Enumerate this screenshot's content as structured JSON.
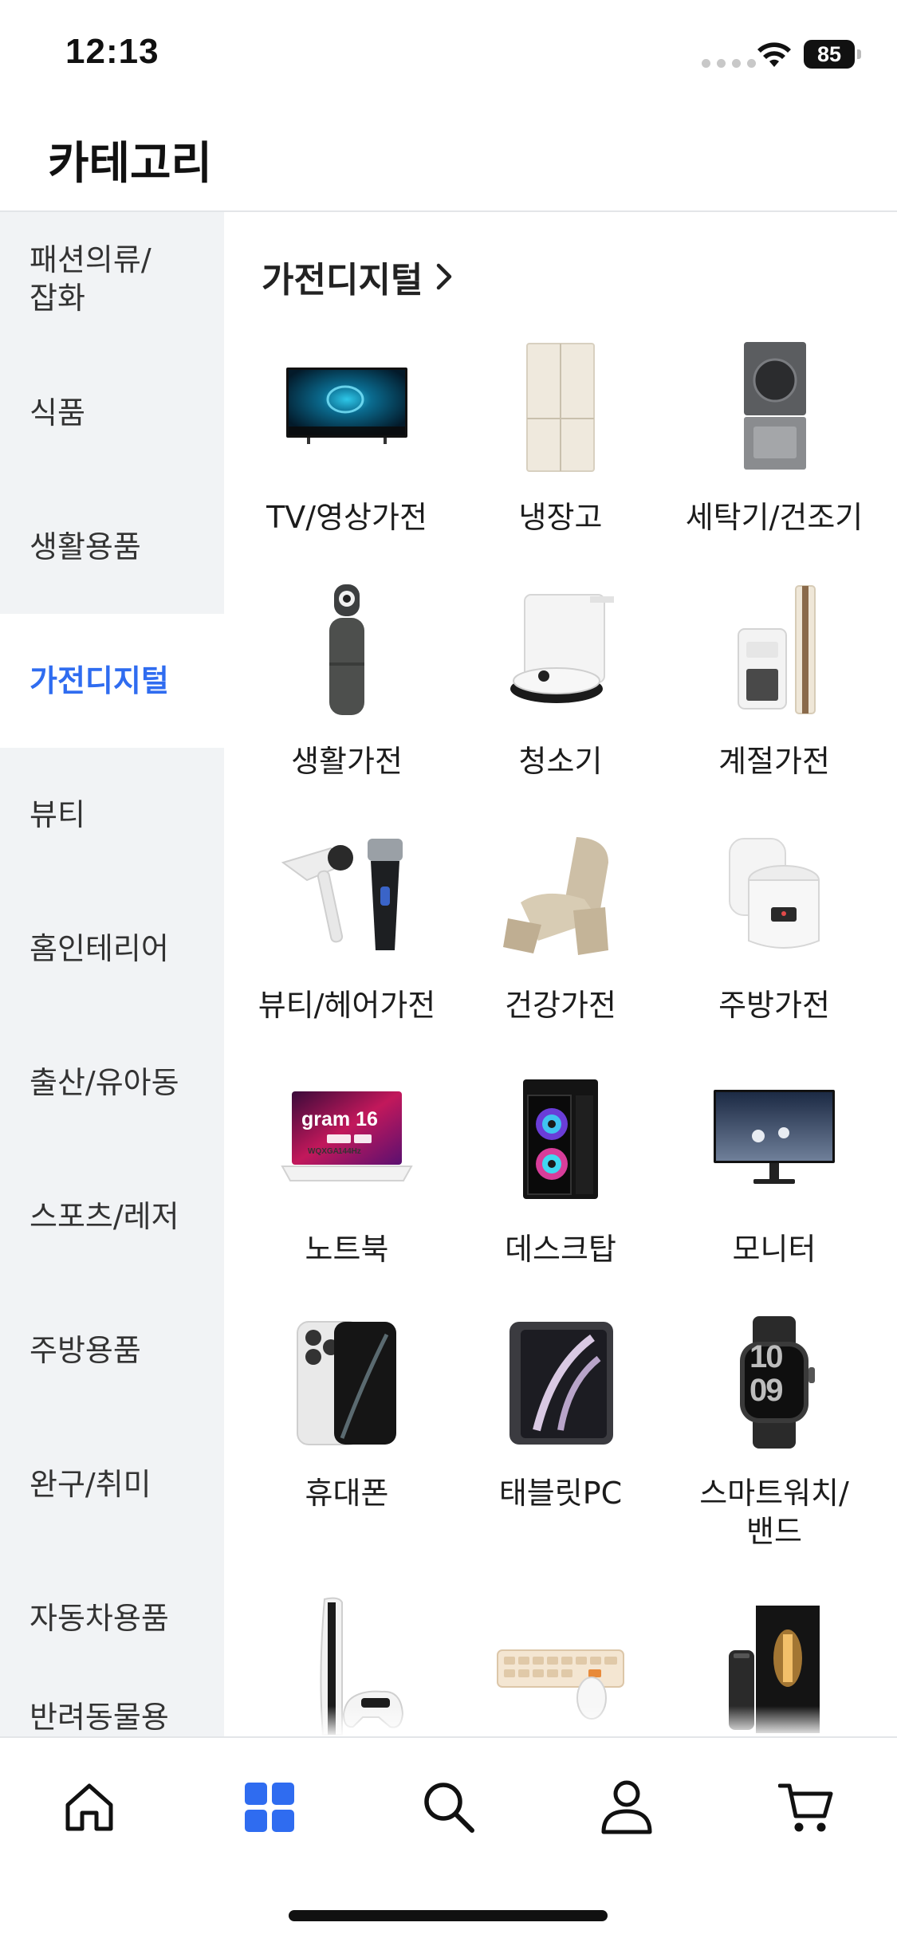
{
  "status_bar": {
    "time": "12:13",
    "battery": "85"
  },
  "header": {
    "title": "카테고리"
  },
  "sidebar": {
    "items": [
      {
        "label": "패션의류/\n잡화",
        "active": false
      },
      {
        "label": "식품",
        "active": false
      },
      {
        "label": "생활용품",
        "active": false
      },
      {
        "label": "가전디지털",
        "active": true
      },
      {
        "label": "뷰티",
        "active": false
      },
      {
        "label": "홈인테리어",
        "active": false
      },
      {
        "label": "출산/유아동",
        "active": false
      },
      {
        "label": "스포츠/레저",
        "active": false
      },
      {
        "label": "주방용품",
        "active": false
      },
      {
        "label": "완구/취미",
        "active": false
      },
      {
        "label": "자동차용품",
        "active": false
      },
      {
        "label": "반려동물용",
        "active": false
      }
    ]
  },
  "section": {
    "title": "가전디지털"
  },
  "subcategories": [
    {
      "label": "TV/영상가전",
      "icon": "tv-icon"
    },
    {
      "label": "냉장고",
      "icon": "refrigerator-icon"
    },
    {
      "label": "세탁기/건조기",
      "icon": "washer-dryer-icon"
    },
    {
      "label": "생활가전",
      "icon": "air-purifier-icon"
    },
    {
      "label": "청소기",
      "icon": "robot-vacuum-icon"
    },
    {
      "label": "계절가전",
      "icon": "air-conditioner-icon"
    },
    {
      "label": "뷰티/헤어가전",
      "icon": "hair-dryer-shaver-icon"
    },
    {
      "label": "건강가전",
      "icon": "massage-chair-icon"
    },
    {
      "label": "주방가전",
      "icon": "rice-cooker-icon"
    },
    {
      "label": "노트북",
      "icon": "laptop-icon"
    },
    {
      "label": "데스크탑",
      "icon": "desktop-pc-icon"
    },
    {
      "label": "모니터",
      "icon": "monitor-icon"
    },
    {
      "label": "휴대폰",
      "icon": "smartphone-icon"
    },
    {
      "label": "태블릿PC",
      "icon": "tablet-icon"
    },
    {
      "label": "스마트워치/\n밴드",
      "icon": "smartwatch-icon"
    },
    {
      "label": "",
      "icon": "game-console-icon"
    },
    {
      "label": "",
      "icon": "keyboard-mouse-icon"
    },
    {
      "label": "",
      "icon": "ssd-icon"
    }
  ],
  "thumb_text": {
    "laptop_brand": "gram 16",
    "laptop_badge_1": "WQXGA",
    "laptop_badge_2": "144Hz",
    "watch_time_top": "10",
    "watch_time_bottom": "09"
  },
  "bottom_nav": [
    {
      "name": "home",
      "icon": "home-icon",
      "active": false
    },
    {
      "name": "categories",
      "icon": "grid-icon",
      "active": true
    },
    {
      "name": "search",
      "icon": "search-icon",
      "active": false
    },
    {
      "name": "my",
      "icon": "user-icon",
      "active": false
    },
    {
      "name": "cart",
      "icon": "cart-icon",
      "active": false
    }
  ],
  "colors": {
    "accent": "#2f6cf0",
    "sidebar_bg": "#f1f3f5",
    "text": "#111111"
  }
}
